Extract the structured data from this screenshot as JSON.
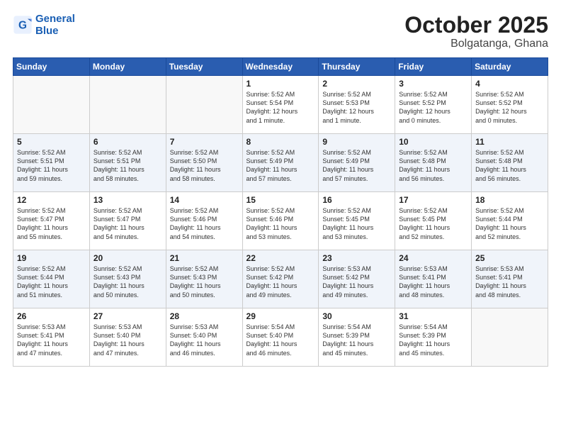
{
  "header": {
    "logo_line1": "General",
    "logo_line2": "Blue",
    "month": "October 2025",
    "location": "Bolgatanga, Ghana"
  },
  "weekdays": [
    "Sunday",
    "Monday",
    "Tuesday",
    "Wednesday",
    "Thursday",
    "Friday",
    "Saturday"
  ],
  "weeks": [
    [
      {
        "day": "",
        "info": ""
      },
      {
        "day": "",
        "info": ""
      },
      {
        "day": "",
        "info": ""
      },
      {
        "day": "1",
        "info": "Sunrise: 5:52 AM\nSunset: 5:54 PM\nDaylight: 12 hours\nand 1 minute."
      },
      {
        "day": "2",
        "info": "Sunrise: 5:52 AM\nSunset: 5:53 PM\nDaylight: 12 hours\nand 1 minute."
      },
      {
        "day": "3",
        "info": "Sunrise: 5:52 AM\nSunset: 5:52 PM\nDaylight: 12 hours\nand 0 minutes."
      },
      {
        "day": "4",
        "info": "Sunrise: 5:52 AM\nSunset: 5:52 PM\nDaylight: 12 hours\nand 0 minutes."
      }
    ],
    [
      {
        "day": "5",
        "info": "Sunrise: 5:52 AM\nSunset: 5:51 PM\nDaylight: 11 hours\nand 59 minutes."
      },
      {
        "day": "6",
        "info": "Sunrise: 5:52 AM\nSunset: 5:51 PM\nDaylight: 11 hours\nand 58 minutes."
      },
      {
        "day": "7",
        "info": "Sunrise: 5:52 AM\nSunset: 5:50 PM\nDaylight: 11 hours\nand 58 minutes."
      },
      {
        "day": "8",
        "info": "Sunrise: 5:52 AM\nSunset: 5:49 PM\nDaylight: 11 hours\nand 57 minutes."
      },
      {
        "day": "9",
        "info": "Sunrise: 5:52 AM\nSunset: 5:49 PM\nDaylight: 11 hours\nand 57 minutes."
      },
      {
        "day": "10",
        "info": "Sunrise: 5:52 AM\nSunset: 5:48 PM\nDaylight: 11 hours\nand 56 minutes."
      },
      {
        "day": "11",
        "info": "Sunrise: 5:52 AM\nSunset: 5:48 PM\nDaylight: 11 hours\nand 56 minutes."
      }
    ],
    [
      {
        "day": "12",
        "info": "Sunrise: 5:52 AM\nSunset: 5:47 PM\nDaylight: 11 hours\nand 55 minutes."
      },
      {
        "day": "13",
        "info": "Sunrise: 5:52 AM\nSunset: 5:47 PM\nDaylight: 11 hours\nand 54 minutes."
      },
      {
        "day": "14",
        "info": "Sunrise: 5:52 AM\nSunset: 5:46 PM\nDaylight: 11 hours\nand 54 minutes."
      },
      {
        "day": "15",
        "info": "Sunrise: 5:52 AM\nSunset: 5:46 PM\nDaylight: 11 hours\nand 53 minutes."
      },
      {
        "day": "16",
        "info": "Sunrise: 5:52 AM\nSunset: 5:45 PM\nDaylight: 11 hours\nand 53 minutes."
      },
      {
        "day": "17",
        "info": "Sunrise: 5:52 AM\nSunset: 5:45 PM\nDaylight: 11 hours\nand 52 minutes."
      },
      {
        "day": "18",
        "info": "Sunrise: 5:52 AM\nSunset: 5:44 PM\nDaylight: 11 hours\nand 52 minutes."
      }
    ],
    [
      {
        "day": "19",
        "info": "Sunrise: 5:52 AM\nSunset: 5:44 PM\nDaylight: 11 hours\nand 51 minutes."
      },
      {
        "day": "20",
        "info": "Sunrise: 5:52 AM\nSunset: 5:43 PM\nDaylight: 11 hours\nand 50 minutes."
      },
      {
        "day": "21",
        "info": "Sunrise: 5:52 AM\nSunset: 5:43 PM\nDaylight: 11 hours\nand 50 minutes."
      },
      {
        "day": "22",
        "info": "Sunrise: 5:52 AM\nSunset: 5:42 PM\nDaylight: 11 hours\nand 49 minutes."
      },
      {
        "day": "23",
        "info": "Sunrise: 5:53 AM\nSunset: 5:42 PM\nDaylight: 11 hours\nand 49 minutes."
      },
      {
        "day": "24",
        "info": "Sunrise: 5:53 AM\nSunset: 5:41 PM\nDaylight: 11 hours\nand 48 minutes."
      },
      {
        "day": "25",
        "info": "Sunrise: 5:53 AM\nSunset: 5:41 PM\nDaylight: 11 hours\nand 48 minutes."
      }
    ],
    [
      {
        "day": "26",
        "info": "Sunrise: 5:53 AM\nSunset: 5:41 PM\nDaylight: 11 hours\nand 47 minutes."
      },
      {
        "day": "27",
        "info": "Sunrise: 5:53 AM\nSunset: 5:40 PM\nDaylight: 11 hours\nand 47 minutes."
      },
      {
        "day": "28",
        "info": "Sunrise: 5:53 AM\nSunset: 5:40 PM\nDaylight: 11 hours\nand 46 minutes."
      },
      {
        "day": "29",
        "info": "Sunrise: 5:54 AM\nSunset: 5:40 PM\nDaylight: 11 hours\nand 46 minutes."
      },
      {
        "day": "30",
        "info": "Sunrise: 5:54 AM\nSunset: 5:39 PM\nDaylight: 11 hours\nand 45 minutes."
      },
      {
        "day": "31",
        "info": "Sunrise: 5:54 AM\nSunset: 5:39 PM\nDaylight: 11 hours\nand 45 minutes."
      },
      {
        "day": "",
        "info": ""
      }
    ]
  ]
}
